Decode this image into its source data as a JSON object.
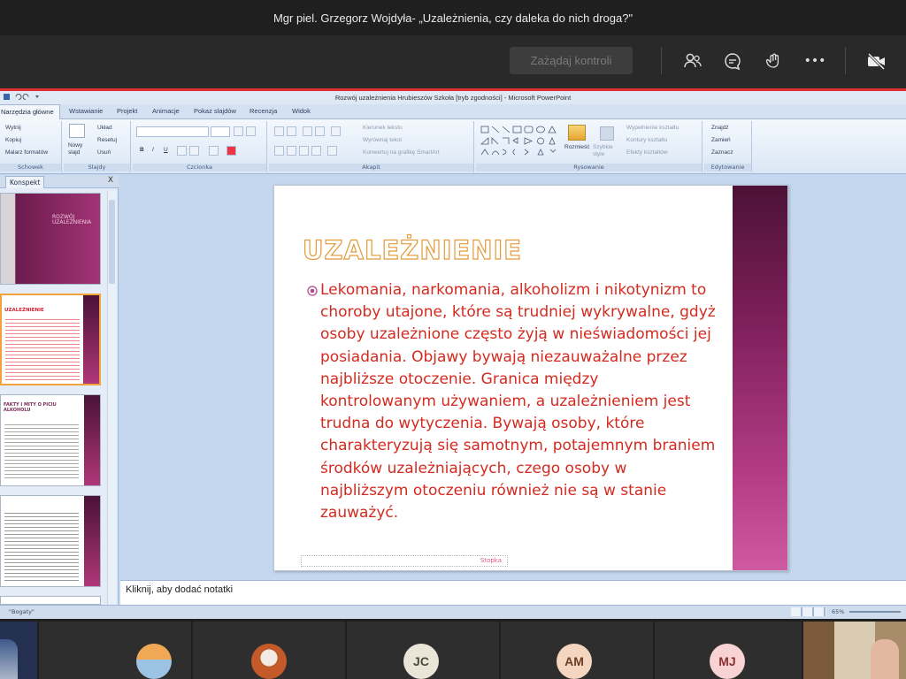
{
  "meeting": {
    "title": "Mgr piel. Grzegorz Wojdyła- „Uzależnienia, czy daleka do nich droga?\"",
    "request_control_label": "Zażądaj kontroli",
    "more_label": "•••"
  },
  "powerpoint": {
    "window_title": "Rozwój uzależnienia Hrubieszów Szkoła [tryb zgodności] - Microsoft PowerPoint",
    "tabs": [
      "Narzędzia główne",
      "Wstawianie",
      "Projekt",
      "Animacje",
      "Pokaz slajdów",
      "Recenzja",
      "Widok"
    ],
    "ribbon": {
      "clipboard": {
        "label": "Schowek",
        "cut": "Wytnij",
        "copy": "Kopiuj",
        "paint": "Malarz formatów"
      },
      "slides": {
        "label": "Slajdy",
        "new_slide": "Nowy slajd",
        "layout": "Układ",
        "reset": "Resetuj",
        "delete": "Usuń"
      },
      "font": {
        "label": "Czcionka"
      },
      "paragraph": {
        "label": "Akapit",
        "text_dir": "Kierunek tekstu",
        "align_text": "Wyrównaj tekst",
        "smartart": "Konwertuj na grafikę SmartArt"
      },
      "drawing": {
        "label": "Rysowanie",
        "arrange": "Rozmieść",
        "quick_styles": "Szybkie style",
        "fill": "Wypełnienie kształtu",
        "outline": "Kontury kształtu",
        "effects": "Efekty kształtów"
      },
      "editing": {
        "label": "Edytowanie",
        "find": "Znajdź",
        "replace": "Zamień",
        "select": "Zaznacz"
      }
    },
    "panel": {
      "tab_label": "Konspekt",
      "close": "X",
      "thumb1_title": "ROZWÓJ UZALEŻNIENIA",
      "thumb2_title": "UZALEŻNIENIE",
      "thumb3_title": "FAKTY I MITY O PICIU ALKOHOLU"
    },
    "slide": {
      "title": "UZALEŻNIENIE",
      "body": "Lekomania, narkomania, alkoholizm i nikotynizm to choroby utajone, które są trudniej wykrywalne, gdyż osoby uzależnione często żyją w nieświadomości jej posiadania. Objawy bywają niezauważalne przez najbliższe otoczenie. Granica między kontrolowanym używaniem, a uzależnieniem jest trudna do wytyczenia. Bywają osoby, które charakteryzują się samotnym, potajemnym braniem środków uzależniających, czego osoby w najbliższym otoczeniu również nie są w stanie zauważyć.",
      "footer": "Stopka"
    },
    "notes_placeholder": "Kliknij, aby dodać notatki",
    "status": {
      "theme": "\"Bogaty\"",
      "zoom": "65%"
    }
  },
  "participants": [
    {
      "initials": "",
      "color": "#8a5a3c"
    },
    {
      "initials": "JC",
      "color": "#e9e6d8",
      "text_color": "#4a4a3a"
    },
    {
      "initials": "AM",
      "color": "#f4d5c0",
      "text_color": "#6b3f25"
    },
    {
      "initials": "MJ",
      "color": "#f7d3d3",
      "text_color": "#8c3030"
    }
  ]
}
